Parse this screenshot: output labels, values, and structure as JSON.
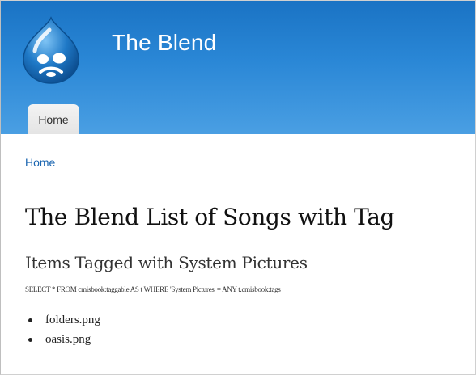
{
  "header": {
    "site_name": "The Blend",
    "logo_icon": "drupal-drop-logo-icon",
    "gradient_colors": [
      "#1a73c4",
      "#4a9fe3"
    ]
  },
  "nav": {
    "tabs": [
      {
        "label": "Home",
        "active": true
      }
    ]
  },
  "breadcrumb": {
    "items": [
      "Home"
    ]
  },
  "main": {
    "title": "The Blend List of Songs with Tag",
    "section_title": "Items Tagged with System Pictures",
    "query": "SELECT * FROM cmisbook:taggable AS t WHERE 'System Pictures' = ANY t.cmisbook:tags",
    "items": [
      "folders.png",
      "oasis.png"
    ]
  },
  "colors": {
    "link": "#1a65b0",
    "tab_background": "#e9e9e9"
  }
}
